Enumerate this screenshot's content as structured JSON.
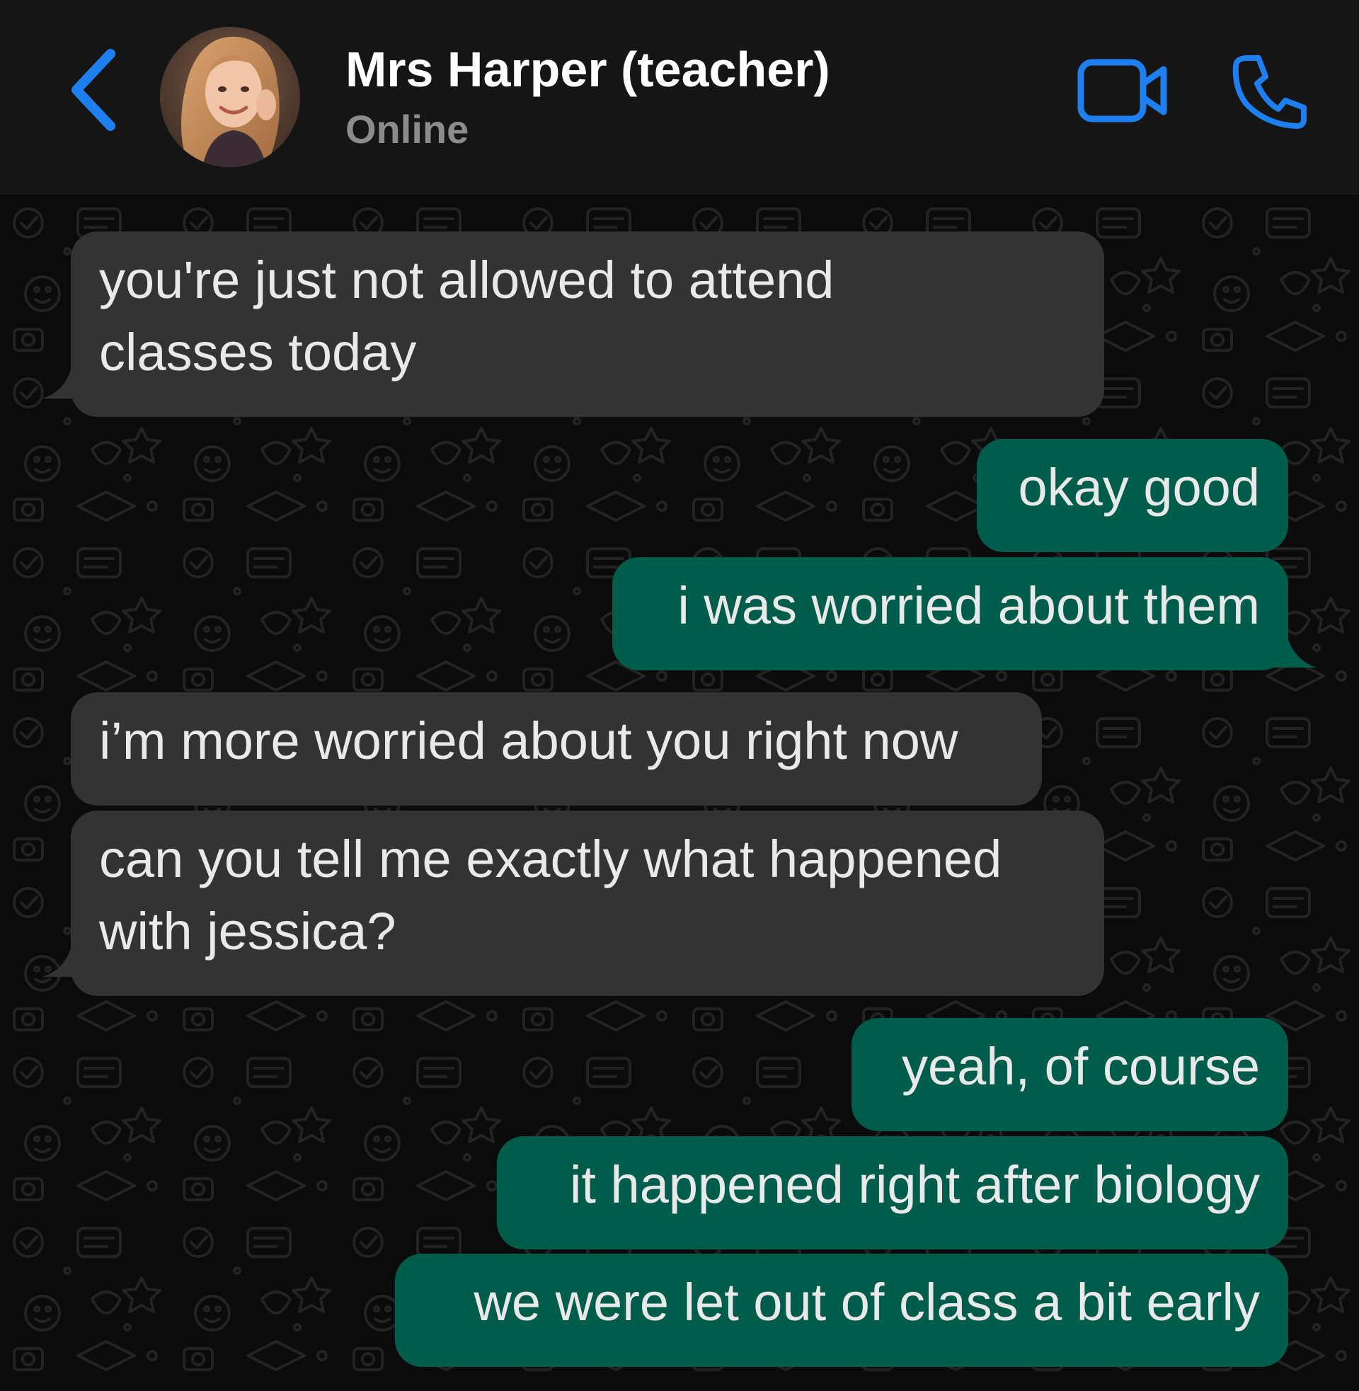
{
  "header": {
    "back_icon": "chevron-left-icon",
    "contact_name": "Mrs Harper (teacher)",
    "status": "Online",
    "video_icon": "video-camera-icon",
    "phone_icon": "phone-icon"
  },
  "colors": {
    "accent": "#1e7ff0",
    "incoming_bubble": "#333333",
    "outgoing_bubble": "#005c4b",
    "header_bg": "#151515",
    "chat_bg": "#0b0b0b"
  },
  "messages": [
    {
      "direction": "incoming",
      "lines": [
        "you're just not allowed to attend",
        "classes today"
      ]
    },
    {
      "direction": "outgoing",
      "lines": [
        "okay good"
      ]
    },
    {
      "direction": "outgoing",
      "lines": [
        "i was worried about them"
      ]
    },
    {
      "direction": "incoming",
      "lines": [
        "i’m more worried about you right now"
      ]
    },
    {
      "direction": "incoming",
      "lines": [
        "can you tell me exactly what happened",
        "with jessica?"
      ]
    },
    {
      "direction": "outgoing",
      "lines": [
        "yeah, of course"
      ]
    },
    {
      "direction": "outgoing",
      "lines": [
        "it happened right after biology"
      ]
    },
    {
      "direction": "outgoing",
      "lines": [
        "we were let out of class a bit early"
      ]
    }
  ]
}
